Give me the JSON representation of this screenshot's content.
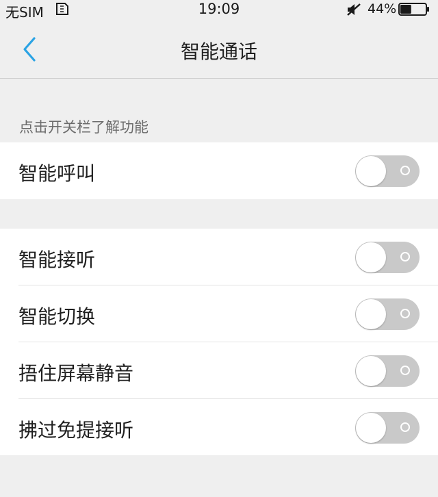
{
  "status_bar": {
    "sim": "无SIM",
    "time": "19:09",
    "battery": "44%",
    "battery_level": 0.44
  },
  "header": {
    "title": "智能通话",
    "back_icon": "chevron-left-icon",
    "accent": "#2aa3e4"
  },
  "section_header": "点击开关栏了解功能",
  "group1": [
    {
      "label": "智能呼叫",
      "enabled": false
    }
  ],
  "group2": [
    {
      "label": "智能接听",
      "enabled": false
    },
    {
      "label": "智能切换",
      "enabled": false
    },
    {
      "label": "捂住屏幕静音",
      "enabled": false
    },
    {
      "label": "拂过免提接听",
      "enabled": false
    }
  ],
  "colors": {
    "toggle_off": "#c9c9c9",
    "background": "#efefef"
  }
}
